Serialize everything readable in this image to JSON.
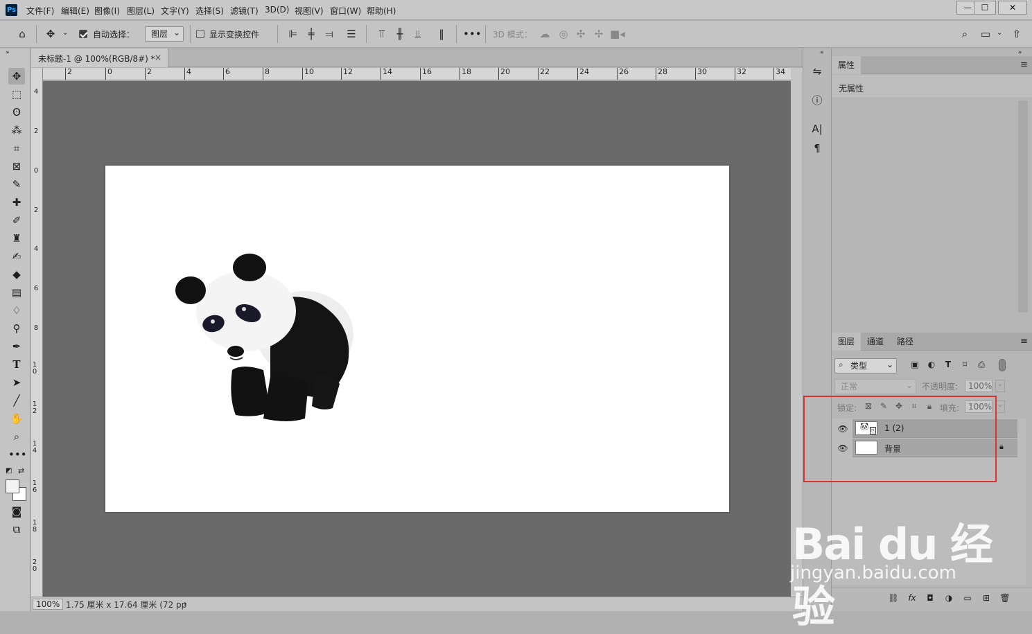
{
  "menubar": {
    "logo": "Ps",
    "items": [
      "文件(F)",
      "编辑(E)",
      "图像(I)",
      "图层(L)",
      "文字(Y)",
      "选择(S)",
      "滤镜(T)",
      "3D(D)",
      "视图(V)",
      "窗口(W)",
      "帮助(H)"
    ],
    "window_controls": {
      "minimize": "—",
      "maximize": "☐",
      "close": "✕"
    }
  },
  "options": {
    "auto_select_label": "自动选择：",
    "auto_select_checked": true,
    "auto_select_value": "图层",
    "show_transform_label": "显示变换控件",
    "show_transform_checked": false,
    "more": "•••",
    "mode_3d_label": "3D 模式："
  },
  "document": {
    "tab_title": "未标题-1 @ 100%(RGB/8#) *",
    "tab_close": "×",
    "ruler_h": [
      "2",
      "0",
      "2",
      "4",
      "6",
      "8",
      "10",
      "12",
      "14",
      "16",
      "18",
      "20",
      "22",
      "24",
      "26",
      "28",
      "30",
      "32",
      "34"
    ],
    "ruler_v": [
      "4",
      "2",
      "0",
      "2",
      "4",
      "6",
      "8",
      "1 0",
      "1 2",
      "1 4",
      "1 6",
      "1 8",
      "2 0"
    ],
    "zoom": "100%",
    "status": "1.75 厘米 x 17.64 厘米 (72 pp",
    "status_arrow": "›"
  },
  "properties_panel": {
    "tab": "属性",
    "menu_icon": "≡",
    "content": "无属性"
  },
  "layers_panel": {
    "tabs": [
      "图层",
      "通道",
      "路径"
    ],
    "filter_label": "类型",
    "blend_mode": "正常",
    "opacity_label": "不透明度:",
    "opacity_value": "100%",
    "lock_label": "锁定:",
    "fill_label": "填充:",
    "fill_value": "100%",
    "layers": [
      {
        "name": "1 (2)",
        "visible": true,
        "selected": true,
        "locked": false
      },
      {
        "name": "背景",
        "visible": true,
        "selected": false,
        "locked": true
      }
    ],
    "bottom_icons": [
      "link-icon",
      "fx-icon",
      "mask-icon",
      "adjustment-icon",
      "folder-icon",
      "new-layer-icon",
      "trash-icon"
    ]
  },
  "watermark": {
    "line1": "Bai du 经验",
    "line2": "jingyan.baidu.com"
  },
  "colors": {
    "highlight_box": "#e03030",
    "canvas_bg": "#6a6a6a",
    "panel_bg": "#b6b6b6"
  }
}
